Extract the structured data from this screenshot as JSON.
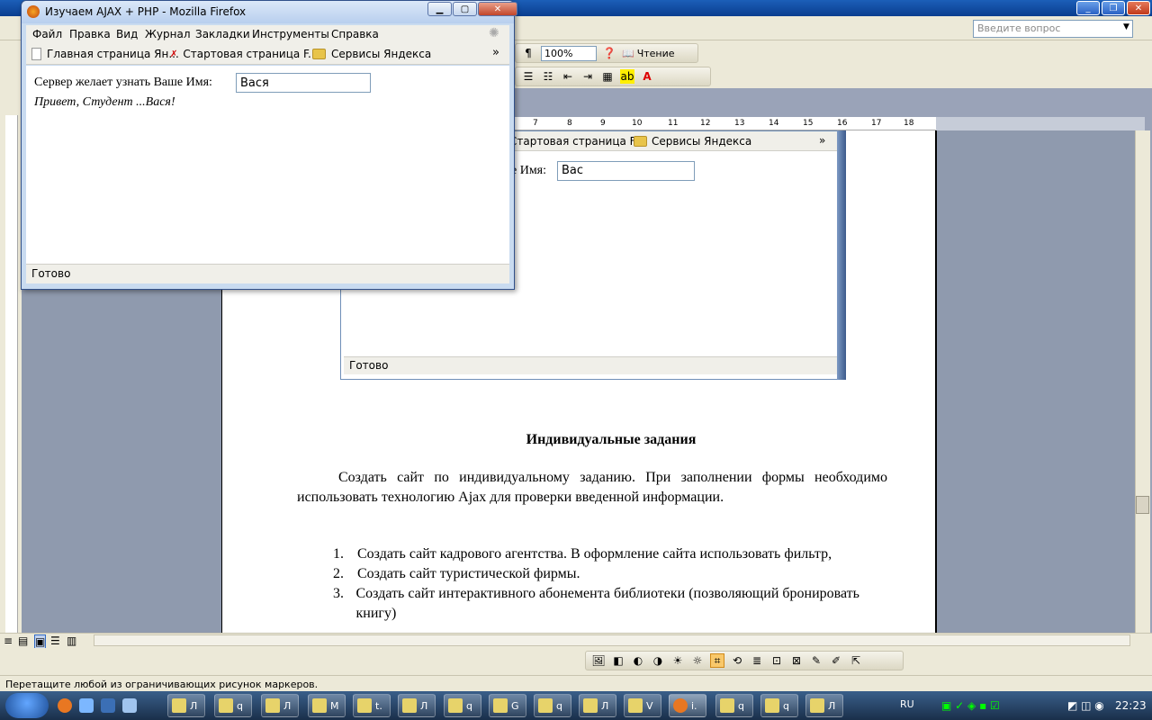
{
  "firefox": {
    "title": "Изучаем AJAX + PHP - Mozilla Firefox",
    "menu": [
      "Файл",
      "Правка",
      "Вид",
      "Журнал",
      "Закладки",
      "Инструменты",
      "Справка"
    ],
    "bookmarks": [
      "Главная страница Ян...",
      "Стартовая страница F...",
      "Сервисы Яндекса"
    ],
    "overflow_glyph": "»",
    "form_label": "Сервер желает узнать Ваше Имя:",
    "name_value": "Вася",
    "greeting": "Привет, Студент ...Вася!",
    "status": "Готово"
  },
  "word": {
    "help_placeholder": "Введите вопрос",
    "zoom": "100%",
    "reading_label": "Чтение",
    "status_text": "Перетащите любой из ограничивающих рисунок маркеров."
  },
  "embedded": {
    "bookmark1": "Стартовая страница F...",
    "bookmark2": "Сервисы Яндекса",
    "label_tail": "е Имя:",
    "input_value": "Вас",
    "status": "Готово"
  },
  "document": {
    "heading": "Индивидуальные задания",
    "paragraph": "Создать сайт по индивидуальному заданию. При заполнении формы необходимо использовать технологию Ajax для проверки введенной информации.",
    "items": [
      {
        "num": "1.",
        "text": "Создать сайт кадрового агентства. В оформление сайта использовать фильтр,"
      },
      {
        "num": "2.",
        "text": "Создать сайт туристической фирмы."
      },
      {
        "num": "3.",
        "text": "Создать сайт интерактивного абонемента библиотеки (позволяющий бронировать книгу)"
      }
    ]
  },
  "ruler_numbers": [
    "7",
    "8",
    "9",
    "10",
    "11",
    "12",
    "13",
    "14",
    "15",
    "16",
    "17",
    "18"
  ],
  "taskbar": {
    "items": [
      "Л",
      "q",
      "Л",
      "М",
      "t.",
      "Л",
      "q",
      "G",
      "q",
      "Л",
      "V",
      "i.",
      "q",
      "q",
      "Л"
    ],
    "lang": "RU",
    "time": "22:23"
  }
}
